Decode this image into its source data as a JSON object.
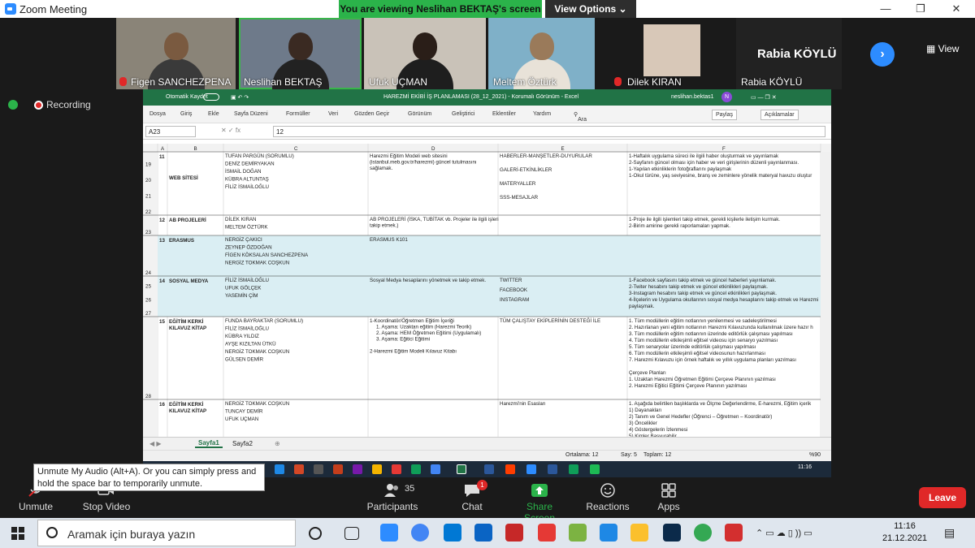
{
  "zoom": {
    "title": "Zoom Meeting",
    "banner": "You are viewing Neslihan BEKTAŞ's screen",
    "view_options": "View Options ⌄",
    "view_label": "View",
    "recording": "Recording",
    "rabia_big": "Rabia KÖYLÜ",
    "next_arrow": "›"
  },
  "participants": [
    {
      "name": "Figen SANCHEZPENA",
      "muted": true
    },
    {
      "name": "Neslihan BEKTAŞ",
      "muted": false
    },
    {
      "name": "Ufuk UÇMAN",
      "muted": false
    },
    {
      "name": "Meltem Öztürk",
      "muted": false
    },
    {
      "name": "Dilek KIRAN",
      "muted": true
    },
    {
      "name": "Rabia KÖYLÜ",
      "muted": false
    }
  ],
  "excel": {
    "autosave": "Otomatik Kaydet",
    "title": "HAREZMİ EKİBİ İŞ PLANLAMASI (28_12_2021)  -  Korumalı Görünüm  -  Excel",
    "user": "neslihan.bektas1",
    "avatar": "N",
    "ribbon": [
      "Dosya",
      "Giriş",
      "Ekle",
      "Sayfa Düzeni",
      "Formüller",
      "Veri",
      "Gözden Geçir",
      "Görünüm",
      "Geliştirici",
      "Eklentiler",
      "Yardım",
      "Ara"
    ],
    "share": "Paylaş",
    "comments": "Açıklamalar",
    "namebox": "A23",
    "formula": "12",
    "cols": [
      "A",
      "B",
      "C",
      "D",
      "E",
      "F"
    ],
    "rows": [
      {
        "rn": [
          "19",
          "20",
          "21",
          "22"
        ],
        "a": "11",
        "b": "WEB SİTESİ",
        "c": [
          "TUFAN PARGÜN (SORUMLU)",
          "DENİZ DEMİRYAKAN",
          "İSMAİL DOĞAN",
          "KÜBRA ALTUNTAŞ",
          "FİLİZ İSMAİLOĞLU"
        ],
        "d": [
          "Harezmi Eğitim Modeli web sitesini",
          "(istanbul.meb.gov.tr/harezmi) güncel tutulmasını",
          "sağlamak."
        ],
        "e": [
          "HABERLER-MANŞETLER-DUYURULAR",
          "GALERİ-ETKİNLİKLER",
          "MATERYALLER",
          "SSS-MESAJLAR"
        ],
        "f": [
          "1-Haftalık uygulama süreci ile ilgili haber oluşturmak ve yayınlamak",
          "2-Sayfanın güncel olması için haber ve veri girişlerinin düzenli yayınlanması.",
          "1-Yapılan etkinliklerin fotoğraflarını paylaşmak",
          "1-Okul türüne, yaş seviyesine, branş ve zeminlere yönelik materyal havuzu oluştur"
        ]
      },
      {
        "rn": [
          "23"
        ],
        "a": "12",
        "b": "AB PROJELERİ",
        "c": [
          "DİLEK KIRAN",
          "MELTEM ÖZTÜRK"
        ],
        "d": [
          "AB PROJELERİ (İSKA, TUBİTAK vb. Projeler ile ilgili işleri",
          "takip etmek.)"
        ],
        "e": [],
        "f": [
          "1-Proje ile ilgili işlemleri takip etmek, gerekli kişilerle iletişim kurmak.",
          "2-Birim amirine gerekli raporlamaları yapmak."
        ]
      },
      {
        "rn": [
          "24"
        ],
        "a": "13",
        "b": "ERASMUS",
        "c": [
          "NERGİZ ÇAKICI",
          "ZEYNEP ÖZDOĞAN",
          "FİGEN KÖKSALAN SANCHEZPENA",
          "NERGİZ TOKMAK COŞKUN"
        ],
        "d": [
          "ERASMUS K101"
        ],
        "e": [],
        "f": []
      },
      {
        "rn": [
          "25",
          "26",
          "27"
        ],
        "a": "14",
        "b": "SOSYAL MEDYA",
        "c": [
          "FİLİZ İSMAİLOĞLU",
          "UFUK GÖLÇEK",
          "YASEMİN ÇİM"
        ],
        "d": [
          "Sosyal Medya hesaplarını yönetmek ve takip etmek."
        ],
        "e": [
          "TWITTER",
          "FACEBOOK",
          "INSTAGRAM"
        ],
        "f": [
          "1-Facebook sayfasını takip etmek ve güncel haberleri yayınlamak.",
          "2-Twiter hesabını takip etmek ve güncel etkinlikleri paylaşmak.",
          "3-Instagram hesabını takip etmek ve güncel etkinlikleri paylaşmak.",
          "4-İlçelerin ve Uygulama okullarının sosyal medya hesaplarını takip etmek ve Harezmi",
          "paylaşmak."
        ]
      },
      {
        "rn": [
          "28"
        ],
        "a": "15",
        "b": "EĞİTİM KERKİ KILAVUZ KİTAP",
        "c": [
          "FUNDA BAYRAKTAR (SORUMLU)",
          "FİLİZ İSMAİLOĞLU",
          "KÜBRA YILDIZ",
          "AYŞE KIZILTAN ÜTKÜ",
          "NERGİZ TOKMAK COŞKUN",
          "GÜLSEN DEMİR"
        ],
        "d": [
          "1-Koordinatör/Öğretmen Eğitim İçeriği",
          "1. Aşama: Uzaktan eğitim (Harezmi Teorik)",
          "2. Aşama: HEM Öğretmen Eğitimi (Uygulamalı)",
          "3. Aşama: Eğitici Eğitimi",
          "",
          "2-Harezmi Eğitim Modeli Kılavuz Kitabı"
        ],
        "e": [
          "TÜM ÇALIŞTAY EKİPLERİNİN DESTEĞİ İLE"
        ],
        "f": [
          "1. Tüm modüllerin eğitim notlarının yenilenmesi ve sadeleştirilmesi",
          "2. Hazırlanan yeni eğitim notlarının Harezmi Kılavuzunda kullanılmak üzere hazır h",
          "3. Tüm modüllerin eğitim notlarının üzerinde editörlük çalışması yapılması",
          "4. Tüm modüllerin etkileşimli eğitsel videosu için senaryo yazılması",
          "5. Tüm senaryolar üzerinde editörlük çalışması yapılması",
          "6. Tüm modüllerin etkileşimli eğitsel videosunun hazırlanması",
          "7. Harezmi Kılavuzu için örnek haftalık ve yıllık uygulama planları yazılması",
          "",
          "Çerçeve Planları",
          "1. Uzaktan Harezmi Öğretmen Eğitimi Çerçeve Planının yazılması",
          "2. Harezmi Eğitici Eğitimi Çerçeve Planının yazılması"
        ]
      },
      {
        "rn": [
          ""
        ],
        "a": "16",
        "b": "EĞİTİM KERKİ KILAVUZ KİTAP",
        "c": [
          "NERGİZ TOKMAK COŞKUN",
          "TUNCAY DEMİR",
          "UFUK UÇMAN"
        ],
        "d": [],
        "e": [
          "Harezmi'nin Esasları"
        ],
        "f": [
          "1. Aşağıda belirtilen başlıklarda ve Ölçme Değerlendirme, E-harezmi, Eğitim içerik",
          "1) Dayanakları",
          "2) Tanım ve Genel Hedefler (Öğrenci – Öğretmen – Koordinatör)",
          "3) Öncelikler",
          "4) Göstergelerin İzlenmesi",
          "5) Kimler Başvurabilir"
        ]
      }
    ],
    "sheets": [
      "Sayfa1",
      "Sayfa2"
    ],
    "status": {
      "avg": "Ortalama: 12",
      "count": "Say: 5",
      "sum": "Toplam: 12",
      "zoom": "%90"
    },
    "remote_clock": "11:16"
  },
  "tooltip": "Unmute My Audio (Alt+A). Or you can simply press and hold the space bar to temporarily unmute.",
  "controls": {
    "unmute": "Unmute",
    "stop_video": "Stop Video",
    "participants": "Participants",
    "participants_count": "35",
    "chat": "Chat",
    "chat_badge": "1",
    "share": "Share Screen",
    "reactions": "Reactions",
    "apps": "Apps",
    "leave": "Leave"
  },
  "taskbar": {
    "search": "Aramak için buraya yazın",
    "time": "11:16",
    "date": "21.12.2021"
  },
  "colors": {
    "excel_green": "#217346",
    "zoom_green": "#2bb34a",
    "leave_red": "#e02828",
    "blue": "#2d8cff",
    "row_blue": "#daeef3"
  }
}
